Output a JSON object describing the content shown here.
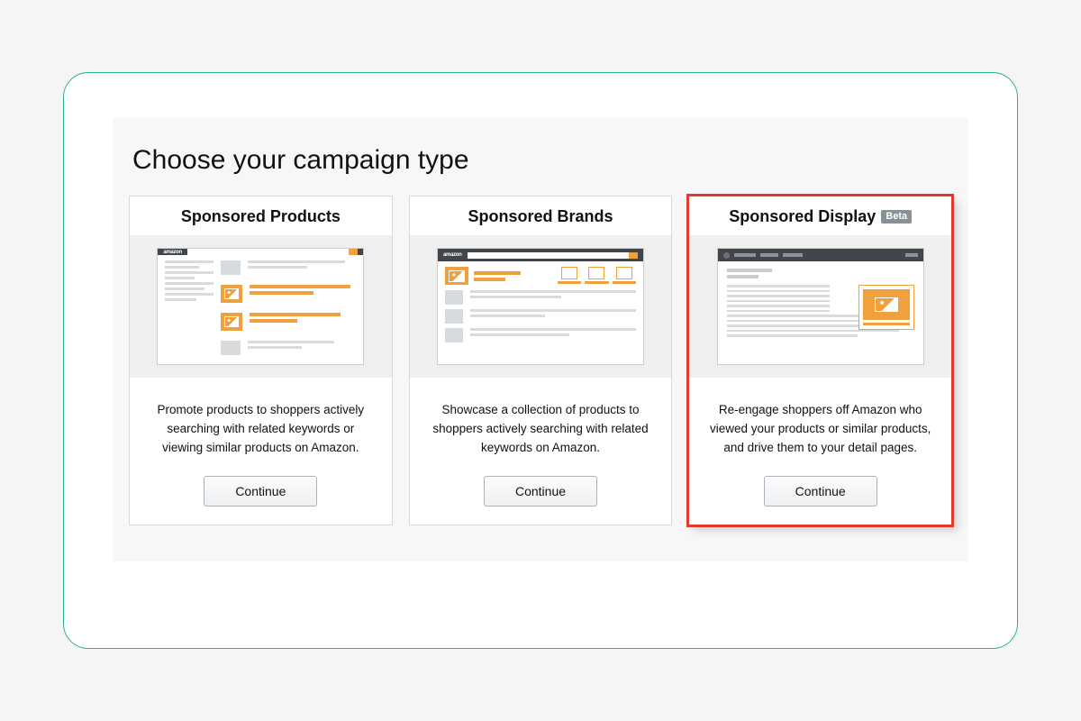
{
  "page": {
    "title": "Choose your campaign type"
  },
  "cards": [
    {
      "title": "Sponsored Products",
      "badge": "",
      "description": "Promote products to shoppers actively searching with related keywords or viewing similar products on Amazon.",
      "cta": "Continue",
      "highlighted": false
    },
    {
      "title": "Sponsored Brands",
      "badge": "",
      "description": "Showcase a collection of products to shoppers actively searching with related keywords on Amazon.",
      "cta": "Continue",
      "highlighted": false
    },
    {
      "title": "Sponsored Display",
      "badge": "Beta",
      "description": "Re-engage shoppers off Amazon who viewed your products or similar products, and drive them to your detail pages.",
      "cta": "Continue",
      "highlighted": true
    }
  ]
}
